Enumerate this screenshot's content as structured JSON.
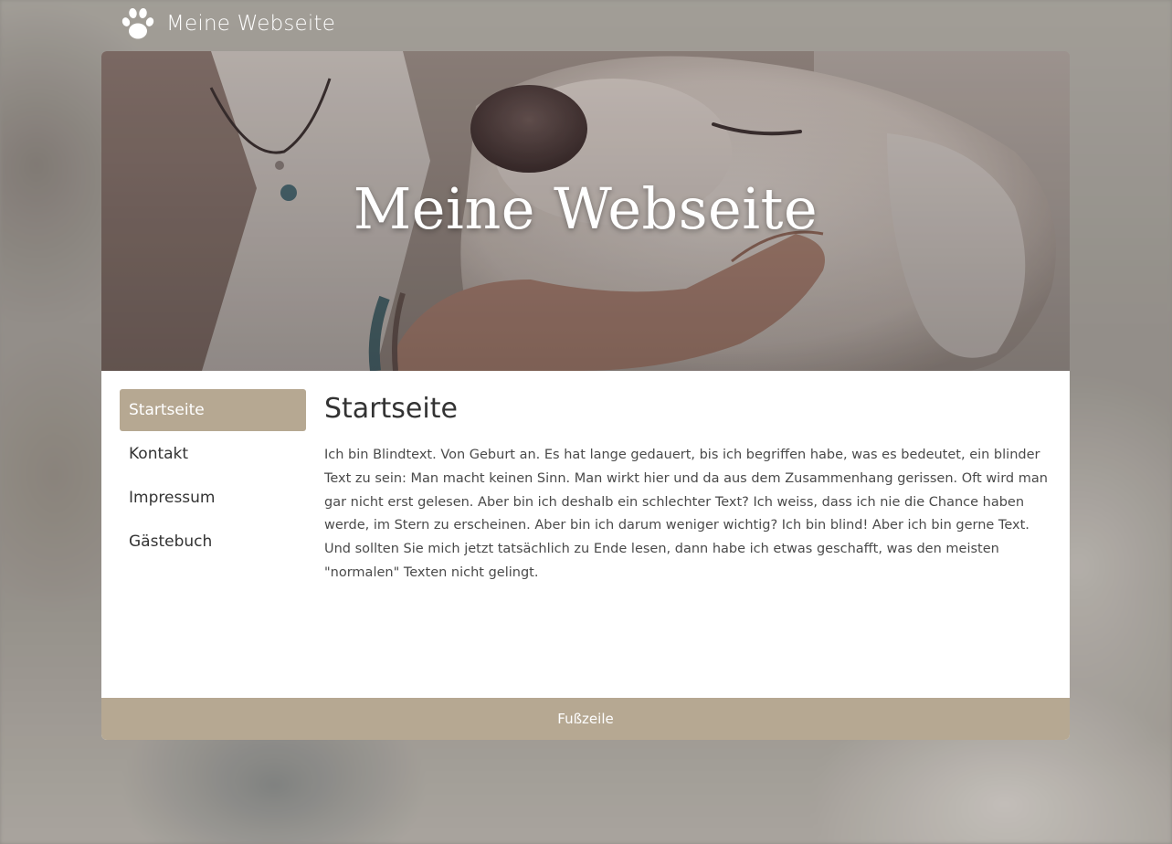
{
  "brand": {
    "title": "Meine Webseite",
    "logo_icon": "paw-icon"
  },
  "hero": {
    "title": "Meine Webseite"
  },
  "nav": {
    "items": [
      {
        "label": "Startseite",
        "active": true
      },
      {
        "label": "Kontakt",
        "active": false
      },
      {
        "label": "Impressum",
        "active": false
      },
      {
        "label": "Gästebuch",
        "active": false
      }
    ]
  },
  "content": {
    "heading": "Startseite",
    "body": "Ich bin Blindtext. Von Geburt an. Es hat lange gedauert, bis ich begriffen habe, was es bedeutet, ein blinder Text zu sein: Man macht keinen Sinn. Man wirkt hier und da aus dem Zusammenhang gerissen. Oft wird man gar nicht erst gelesen. Aber bin ich deshalb ein schlechter Text? Ich weiss, dass ich nie die Chance haben werde, im Stern zu erscheinen. Aber bin ich darum weniger wichtig? Ich bin blind! Aber ich bin gerne Text. Und sollten Sie mich jetzt tatsächlich zu Ende lesen, dann habe ich etwas geschafft, was den meisten \"normalen\" Texten nicht gelingt."
  },
  "footer": {
    "text": "Fußzeile"
  },
  "colors": {
    "accent": "#b6a892",
    "text": "#333333",
    "card_bg": "#ffffff"
  }
}
